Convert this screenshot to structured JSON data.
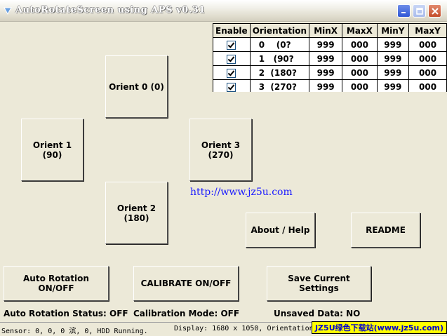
{
  "window": {
    "title": "AutoRotateScreen using APS v0.31"
  },
  "table": {
    "headers": [
      "Enable",
      "Orientation",
      "MinX",
      "MaxX",
      "MinY",
      "MaxY"
    ],
    "rows": [
      {
        "orient_num": "0",
        "orient_label": "(0?",
        "minx": "999",
        "maxx": "000",
        "miny": "999",
        "maxy": "000"
      },
      {
        "orient_num": "1",
        "orient_label": "(90?",
        "minx": "999",
        "maxx": "000",
        "miny": "999",
        "maxy": "000"
      },
      {
        "orient_num": "2",
        "orient_label": "(180?",
        "minx": "999",
        "maxx": "000",
        "miny": "999",
        "maxy": "000"
      },
      {
        "orient_num": "3",
        "orient_label": "(270?",
        "minx": "999",
        "maxx": "000",
        "miny": "999",
        "maxy": "000"
      }
    ]
  },
  "buttons": {
    "orient0": "Orient 0 (0)",
    "orient1": "Orient 1 (90)",
    "orient2": "Orient 2 (180)",
    "orient3": "Orient 3 (270)",
    "about": "About / Help",
    "readme": "README",
    "auto_rotation": "Auto Rotation ON/OFF",
    "calibrate": "CALIBRATE ON/OFF",
    "save": "Save Current Settings"
  },
  "link": "http://www.jz5u.com",
  "status": {
    "auto_rotation": "Auto Rotation Status: OFF",
    "calibration": "Calibration Mode: OFF",
    "unsaved": "Unsaved Data: NO"
  },
  "statusbar": {
    "sensor": "Sensor: 0, 0, 0 滨, 0, HDD Running.",
    "display": "Display: 1680 x 1050, Orientation"
  },
  "watermark": "JZ5U绿色下载站(www.jz5u.com)"
}
